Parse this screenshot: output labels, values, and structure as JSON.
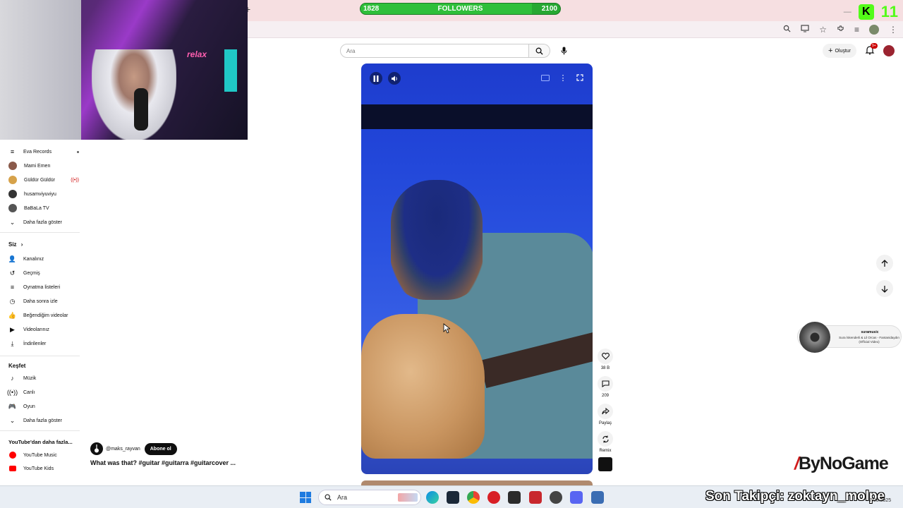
{
  "browser": {
    "new_tab_symbol": "+"
  },
  "follower_goal": {
    "current": "1828",
    "label": "FOLLOWERS",
    "target": "2100",
    "progress_fraction": 0.86,
    "fill_color": "#2fbf3a"
  },
  "overlay": {
    "kick_logo": "K",
    "kick_count": "11",
    "neon_sign": "relax"
  },
  "header": {
    "search_placeholder": "Ara",
    "create_label": "Oluştur",
    "notif_badge": "9+"
  },
  "sidebar": {
    "subscriptions": [
      {
        "label": "Eva Records",
        "icon": "list-icon",
        "extra": "dot"
      },
      {
        "label": "Mami Emen",
        "icon": "avatar"
      },
      {
        "label": "Güldür Güldür",
        "icon": "avatar",
        "extra": "live"
      },
      {
        "label": "husamviyuviyu",
        "icon": "avatar"
      },
      {
        "label": "BaBaLa TV",
        "icon": "avatar"
      }
    ],
    "show_more": "Daha fazla göster",
    "you_heading": "Siz",
    "you_items": [
      {
        "label": "Kanalınız",
        "icon": "channel-icon",
        "glyph": "👤"
      },
      {
        "label": "Geçmiş",
        "icon": "history-icon",
        "glyph": "↺"
      },
      {
        "label": "Oynatma listeleri",
        "icon": "playlist-icon",
        "glyph": "≡"
      },
      {
        "label": "Daha sonra izle",
        "icon": "clock-icon",
        "glyph": "◷"
      },
      {
        "label": "Beğendiğim videolar",
        "icon": "thumb-up-icon",
        "glyph": "👍"
      },
      {
        "label": "Videolarınız",
        "icon": "video-icon",
        "glyph": "▶"
      },
      {
        "label": "İndirilenler",
        "icon": "download-icon",
        "glyph": "⤓"
      }
    ],
    "explore_heading": "Keşfet",
    "explore_items": [
      {
        "label": "Müzik",
        "icon": "music-icon",
        "glyph": "♪"
      },
      {
        "label": "Canlı",
        "icon": "live-icon",
        "glyph": "((•))"
      },
      {
        "label": "Oyun",
        "icon": "gamepad-icon",
        "glyph": "🎮"
      }
    ],
    "explore_more": "Daha fazla göster",
    "more_from_heading": "YouTube'dan daha fazla...",
    "more_items": [
      {
        "label": "YouTube Music",
        "icon": "youtube-music-icon",
        "color": "#ff0000"
      },
      {
        "label": "YouTube Kids",
        "icon": "youtube-kids-icon",
        "color": "#ff0000"
      }
    ]
  },
  "short": {
    "channel_handle": "@maks_rayvan",
    "subscribe_label": "Abone ol",
    "title": "What was that? #guitar #guitarra #guitarcover ...",
    "likes": "38 B",
    "comments": "209",
    "share_label": "Paylaş",
    "remix_label": "Remix"
  },
  "music_widget": {
    "artist": "suramusic",
    "song": "Sura İskenderli & Lil Orcas - Fantanidaydın (Official Video)"
  },
  "sponsor": {
    "logo_text": "ByNoGame"
  },
  "taskbar": {
    "search_label": "Ara",
    "ticker": "Son Takipçi: zoktayn_molpe",
    "date": "7.08.2025"
  },
  "colors": {
    "accent_red": "#cc0000",
    "video_blue": "#2145d8",
    "kick_green": "#53fc18"
  }
}
